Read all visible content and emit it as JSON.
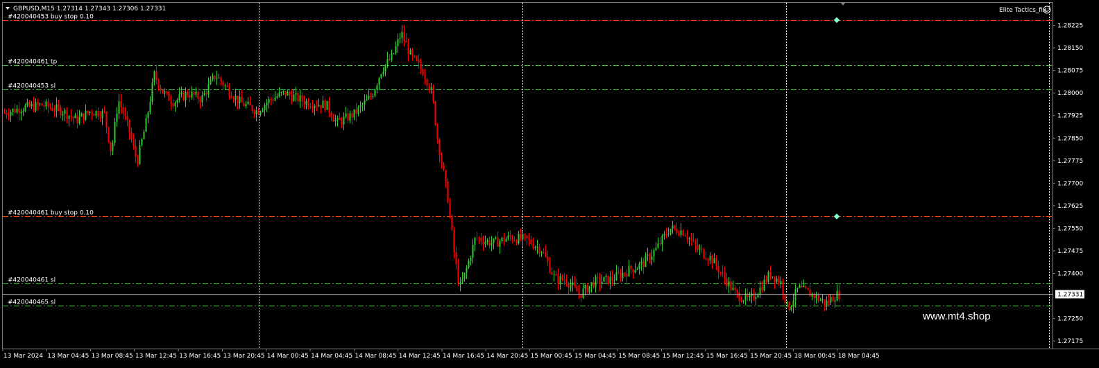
{
  "header": {
    "symbol_info": "GBPUSD,M15  1.27314 1.27343 1.27306 1.27331",
    "indicator": "Elite Tactics_fix",
    "indicator_icon": "smiley-icon"
  },
  "watermark": "www.mt4.shop",
  "colors": {
    "background": "#000000",
    "bull": "#32cd32",
    "bear": "#ff0000",
    "grid_sep": "#ffffff",
    "sl_tp_line": "#32cd32",
    "order_line": "#ff4500",
    "bid_line": "#c0c0c0",
    "marker": "#7fffd4"
  },
  "order_lines": [
    {
      "label": "#420040453 buy stop 0.10",
      "price": 1.28243,
      "kind": "order"
    },
    {
      "label": "#420040461 tp",
      "price": 1.28092,
      "kind": "sltp"
    },
    {
      "label": "#420040453 sl",
      "price": 1.28011,
      "kind": "sltp"
    },
    {
      "label": "#420040461 buy stop 0.10",
      "price": 1.2759,
      "kind": "order"
    },
    {
      "label": "#420040461 sl",
      "price": 1.27367,
      "kind": "sltp"
    },
    {
      "label": "#420040465 sl",
      "price": 1.27294,
      "kind": "sltp"
    }
  ],
  "price_axis": {
    "ticks": [
      "1.28225",
      "1.28150",
      "1.28075",
      "1.28000",
      "1.27925",
      "1.27850",
      "1.27775",
      "1.27700",
      "1.27625",
      "1.27550",
      "1.27475",
      "1.27400",
      "1.27331",
      "1.27250",
      "1.27175"
    ],
    "current_price": "1.27331"
  },
  "time_axis": {
    "ticks": [
      "13 Mar 2024",
      "13 Mar 04:45",
      "13 Mar 08:45",
      "13 Mar 12:45",
      "13 Mar 16:45",
      "13 Mar 20:45",
      "14 Mar 00:45",
      "14 Mar 04:45",
      "14 Mar 08:45",
      "14 Mar 12:45",
      "14 Mar 16:45",
      "14 Mar 20:45",
      "15 Mar 00:45",
      "15 Mar 04:45",
      "15 Mar 08:45",
      "15 Mar 12:45",
      "15 Mar 16:45",
      "15 Mar 20:45",
      "18 Mar 00:45",
      "18 Mar 04:45"
    ]
  },
  "chart_data": {
    "type": "candlestick",
    "symbol": "GBPUSD",
    "timeframe": "M15",
    "ylim": [
      1.2715,
      1.283
    ],
    "price_path": [
      [
        0,
        1.2793
      ],
      [
        30,
        1.2795
      ],
      [
        60,
        1.2796
      ],
      [
        90,
        1.2794
      ],
      [
        110,
        1.2791
      ],
      [
        130,
        1.2794
      ],
      [
        150,
        1.2793
      ],
      [
        160,
        1.278
      ],
      [
        170,
        1.2798
      ],
      [
        185,
        1.2788
      ],
      [
        197,
        1.2777
      ],
      [
        210,
        1.279
      ],
      [
        222,
        1.2806
      ],
      [
        235,
        1.28
      ],
      [
        250,
        1.2797
      ],
      [
        270,
        1.28
      ],
      [
        290,
        1.2798
      ],
      [
        310,
        1.2806
      ],
      [
        325,
        1.2802
      ],
      [
        345,
        1.2797
      ],
      [
        370,
        1.2794
      ],
      [
        390,
        1.2798
      ],
      [
        410,
        1.28
      ],
      [
        440,
        1.2797
      ],
      [
        470,
        1.2796
      ],
      [
        485,
        1.279
      ],
      [
        510,
        1.2793
      ],
      [
        535,
        1.2799
      ],
      [
        550,
        1.2808
      ],
      [
        565,
        1.2812
      ],
      [
        578,
        1.282
      ],
      [
        592,
        1.2812
      ],
      [
        610,
        1.2807
      ],
      [
        622,
        1.28
      ],
      [
        630,
        1.2785
      ],
      [
        645,
        1.2765
      ],
      [
        655,
        1.2745
      ],
      [
        662,
        1.2735
      ],
      [
        670,
        1.274
      ],
      [
        685,
        1.2752
      ],
      [
        710,
        1.275
      ],
      [
        735,
        1.2752
      ],
      [
        760,
        1.2751
      ],
      [
        780,
        1.2748
      ],
      [
        800,
        1.2738
      ],
      [
        815,
        1.2738
      ],
      [
        835,
        1.2733
      ],
      [
        855,
        1.2737
      ],
      [
        880,
        1.2738
      ],
      [
        905,
        1.2741
      ],
      [
        925,
        1.2743
      ],
      [
        945,
        1.2748
      ],
      [
        965,
        1.2755
      ],
      [
        985,
        1.2754
      ],
      [
        1005,
        1.2748
      ],
      [
        1025,
        1.2745
      ],
      [
        1045,
        1.2738
      ],
      [
        1060,
        1.2733
      ],
      [
        1080,
        1.2731
      ],
      [
        1095,
        1.2735
      ],
      [
        1110,
        1.274
      ],
      [
        1125,
        1.2737
      ],
      [
        1135,
        1.2728
      ],
      [
        1150,
        1.2735
      ],
      [
        1170,
        1.2733
      ],
      [
        1190,
        1.273
      ],
      [
        1205,
        1.2733
      ],
      [
        1210,
        1.2733
      ]
    ],
    "last_price": 1.27331
  }
}
